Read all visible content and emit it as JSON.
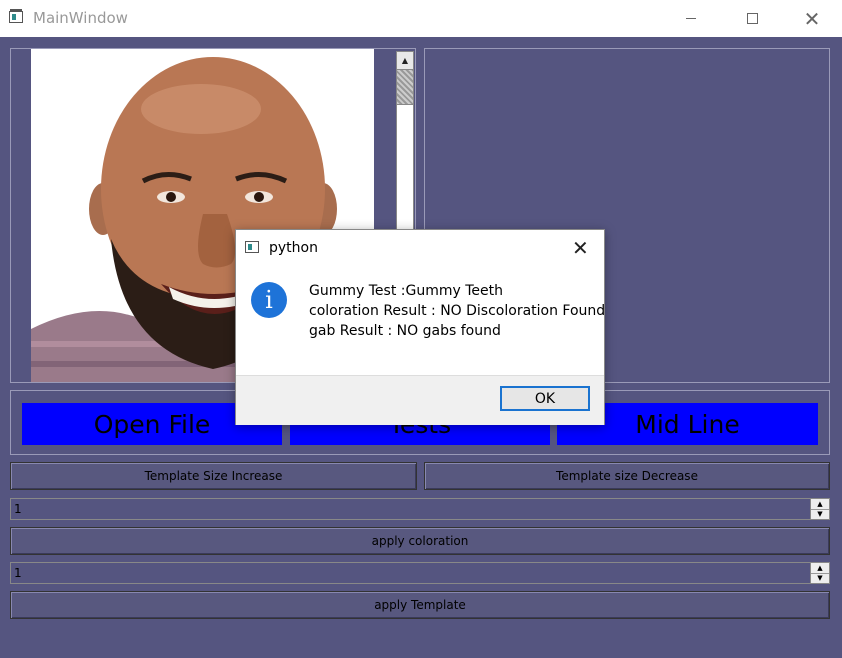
{
  "window": {
    "title": "MainWindow"
  },
  "buttons": {
    "open_file": "Open File",
    "tests": "Tests",
    "mid_line": "Mid Line",
    "template_increase": "Template Size Increase",
    "template_decrease": "Template size Decrease",
    "apply_coloration": "apply coloration",
    "apply_template": "apply Template"
  },
  "spinboxes": {
    "coloration_value": "1",
    "template_value": "1"
  },
  "dialog": {
    "title": "python",
    "icon": "information-icon",
    "lines": [
      "Gummy Test :Gummy Teeth",
      "coloration Result : NO Discoloration Found",
      "gab Result : NO gabs found"
    ],
    "ok_label": "OK"
  },
  "colors": {
    "background": "#555580",
    "accent_button": "#0000ff",
    "info_icon": "#1e73d8"
  }
}
